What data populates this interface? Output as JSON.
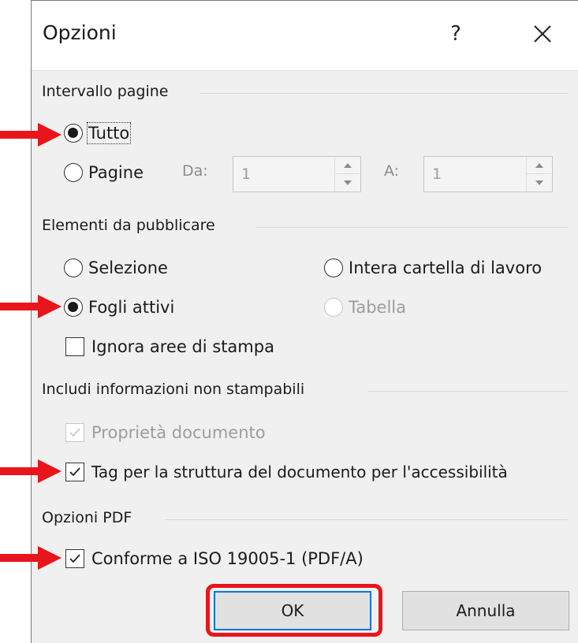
{
  "dialog": {
    "title": "Opzioni",
    "help_label": "?"
  },
  "page_range": {
    "label": "Intervallo pagine",
    "all_label": "Tutto",
    "pages_label": "Pagine",
    "from_label": "Da:",
    "from_value": "1",
    "to_label": "A:",
    "to_value": "1",
    "selected": "all"
  },
  "publish": {
    "label": "Elementi da pubblicare",
    "selection_label": "Selezione",
    "workbook_label": "Intera cartella di lavoro",
    "active_sheets_label": "Fogli attivi",
    "table_label": "Tabella",
    "ignore_print_areas_label": "Ignora aree di stampa",
    "selected": "active_sheets",
    "ignore_print_areas_checked": false
  },
  "nonprint": {
    "label": "Includi informazioni non stampabili",
    "doc_properties_label": "Proprietà documento",
    "doc_properties_checked": true,
    "accessibility_tags_label": "Tag per la struttura del documento per l'accessibilità",
    "accessibility_tags_checked": true
  },
  "pdf": {
    "label": "Opzioni PDF",
    "iso_label": "Conforme a ISO 19005-1 (PDF/A)",
    "iso_checked": true
  },
  "buttons": {
    "ok_label": "OK",
    "cancel_label": "Annulla"
  },
  "colors": {
    "annotation_red": "#e8151b",
    "dialog_background": "#f0f0f0",
    "focus_blue": "#0078d7"
  },
  "icons": {
    "close": "close-icon",
    "annotation": "red-arrow-icon",
    "spinner_up": "spinner-up-icon",
    "spinner_down": "spinner-down-icon",
    "check": "checkmark-icon"
  }
}
